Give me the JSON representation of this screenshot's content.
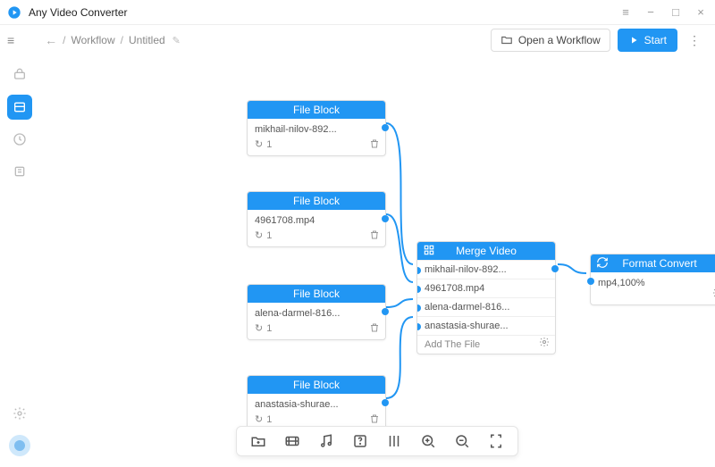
{
  "app": {
    "title": "Any Video Converter"
  },
  "crumbs": {
    "root": "Workflow",
    "current": "Untitled"
  },
  "actions": {
    "open": "Open a Workflow",
    "start": "Start"
  },
  "nodes": {
    "file1": {
      "title": "File Block",
      "name": "mikhail-nilov-892...",
      "count": "1"
    },
    "file2": {
      "title": "File Block",
      "name": "4961708.mp4",
      "count": "1"
    },
    "file3": {
      "title": "File Block",
      "name": "alena-darmel-816...",
      "count": "1"
    },
    "file4": {
      "title": "File Block",
      "name": "anastasia-shurae...",
      "count": "1"
    },
    "merge": {
      "title": "Merge Video",
      "rows": [
        "mikhail-nilov-892...",
        "4961708.mp4",
        "alena-darmel-816...",
        "anastasia-shurae..."
      ],
      "add": "Add The File"
    },
    "format": {
      "title": "Format Convert",
      "value": "mp4,100%"
    }
  }
}
